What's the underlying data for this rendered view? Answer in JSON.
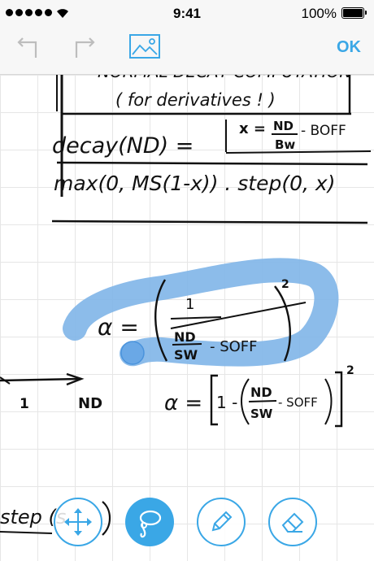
{
  "status_bar": {
    "time": "9:41",
    "battery_percent": "100%",
    "signal_bars": 5
  },
  "toolbar": {
    "undo_icon": "undo-arrow-icon",
    "redo_icon": "redo-arrow-icon",
    "image_icon": "image-icon",
    "ok_label": "OK"
  },
  "handwriting": {
    "box_title_line1": "NORMAL DECAY COMPUTATION",
    "box_title_line2": "( for derivatives ! )",
    "decay_label": "decay(ND) =",
    "x_definition_lhs": "x =",
    "x_definition_num": "ND",
    "x_definition_den": "Bw",
    "x_definition_rhs": "- BOFF",
    "max_expression": "max(0, MS(1-x)) . step(0, x)",
    "alpha_eq_lhs": "α =",
    "alpha_eq_one": "1",
    "alpha_eq_num": "ND",
    "alpha_eq_den": "SW",
    "alpha_eq_soff": "- SOFF",
    "alpha_eq_exp": "2",
    "axis_one": "1",
    "axis_nd": "ND",
    "alpha2_lhs": "α =",
    "alpha2_one_minus": "1 -",
    "alpha2_num": "ND",
    "alpha2_den": "SW",
    "alpha2_soff": "- SOFF",
    "alpha2_exp": "2",
    "bottom_step": "step (s"
  },
  "tools": {
    "move_icon": "move-arrows-icon",
    "lasso_icon": "lasso-icon",
    "pen_icon": "pencil-icon",
    "eraser_icon": "eraser-icon",
    "active_tool": "lasso"
  },
  "colors": {
    "accent": "#3aa7e6",
    "lasso_highlight": "#7fb5e8",
    "ink": "#111111"
  }
}
